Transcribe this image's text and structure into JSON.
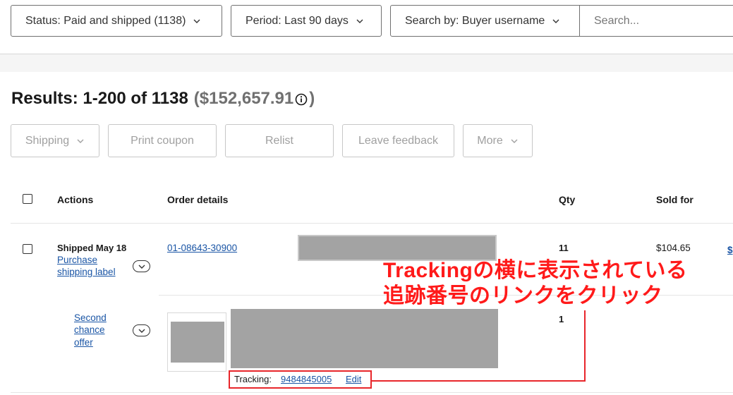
{
  "filters": {
    "status": "Status: Paid and shipped (1138)",
    "period": "Period: Last 90 days",
    "search_by": "Search by: Buyer username",
    "search_placeholder": "Search..."
  },
  "results": {
    "label": "Results: 1-200 of 1138",
    "total": "($152,657.91",
    "close_paren": ")"
  },
  "actions": {
    "shipping": "Shipping",
    "print_coupon": "Print coupon",
    "relist": "Relist",
    "leave_feedback": "Leave feedback",
    "more": "More"
  },
  "table": {
    "headers": {
      "actions": "Actions",
      "order_details": "Order details",
      "qty": "Qty",
      "sold_for": "Sold for"
    },
    "rows": [
      {
        "status": "Shipped May 18",
        "action_link_1": "Purchase",
        "action_link_2": "shipping label",
        "order_number": "01-08643-30900",
        "qty": "11",
        "sold_for": "$104.65",
        "overflow_link": "$"
      },
      {
        "action_link_1": "Second",
        "action_link_2": "chance",
        "action_link_3": "offer",
        "qty": "1",
        "tracking_label": "Tracking:",
        "tracking_number": "9484845005",
        "edit": "Edit"
      }
    ]
  },
  "annotation": {
    "line1": "Trackingの横に表示されている",
    "line2": "追跡番号のリンクをクリック",
    "color": "#ff1a1a"
  }
}
